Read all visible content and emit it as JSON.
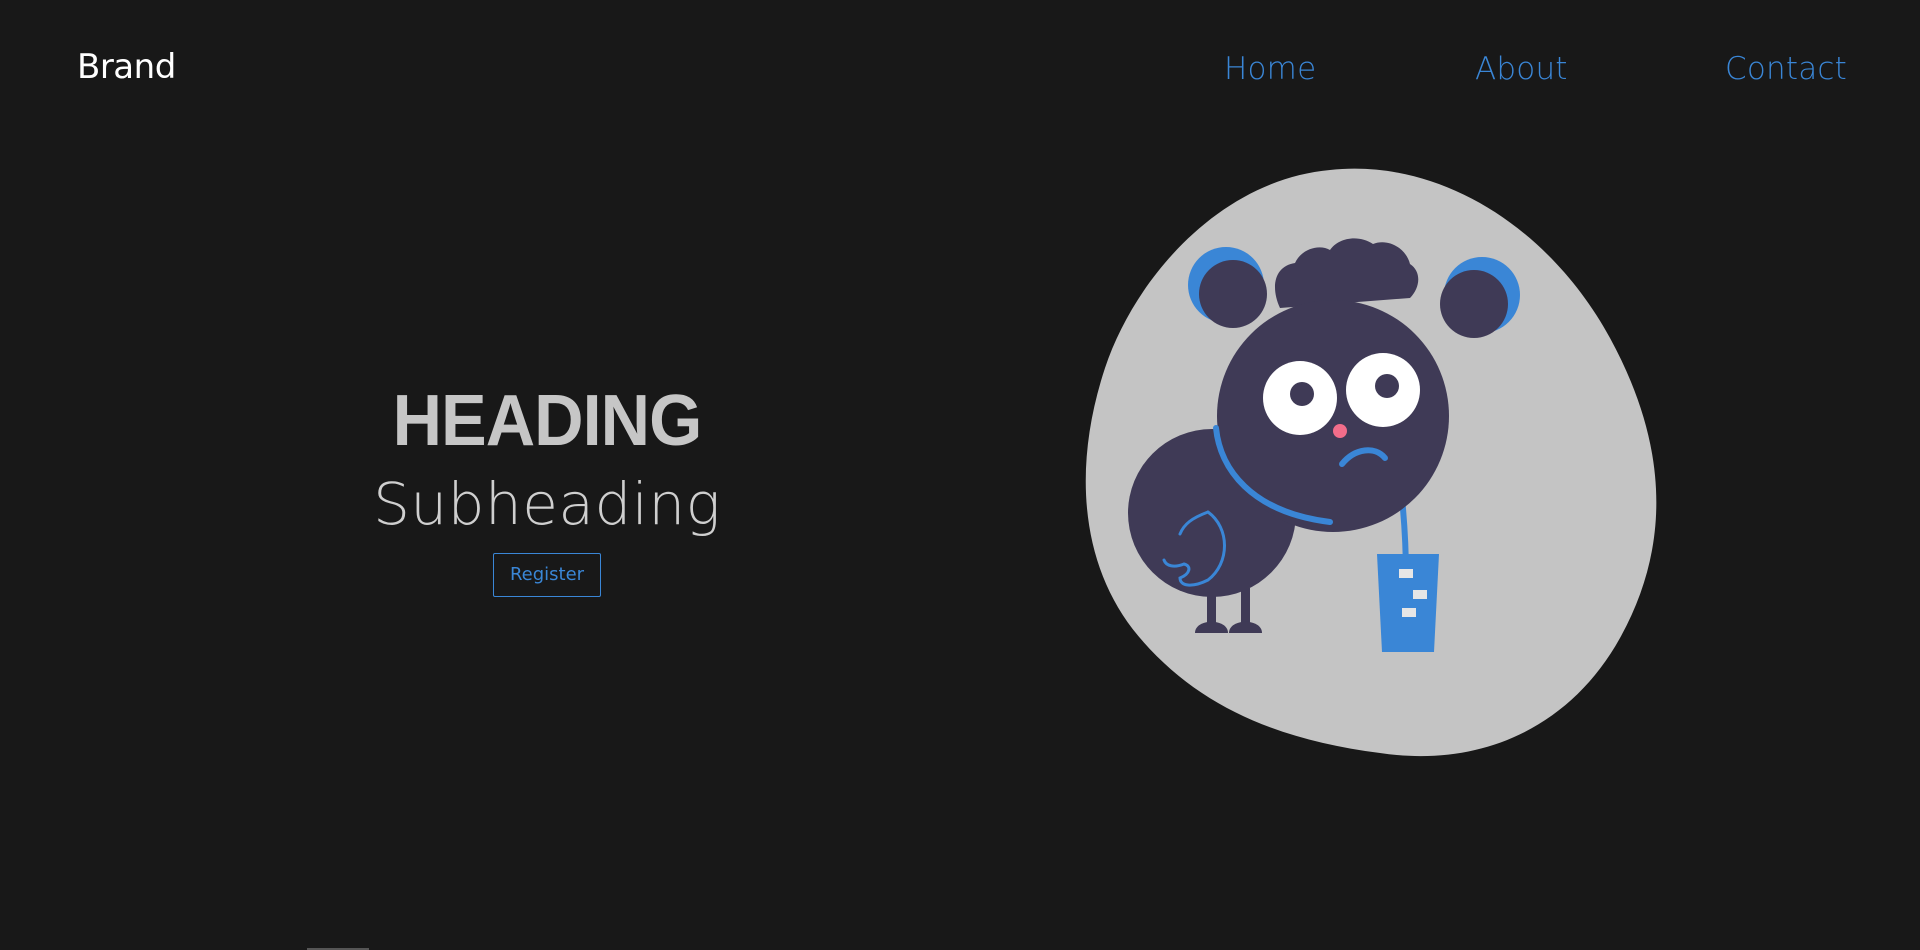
{
  "navbar": {
    "brand": "Brand",
    "links": {
      "home": "Home",
      "about": "About",
      "contact": "Contact"
    }
  },
  "hero": {
    "heading": "HEADING",
    "subheading": "Subheading",
    "register_label": "Register"
  },
  "colors": {
    "background": "#181818",
    "accent": "#3a86d6",
    "blob": "#c4c4c4",
    "character": "#3f3a56"
  }
}
